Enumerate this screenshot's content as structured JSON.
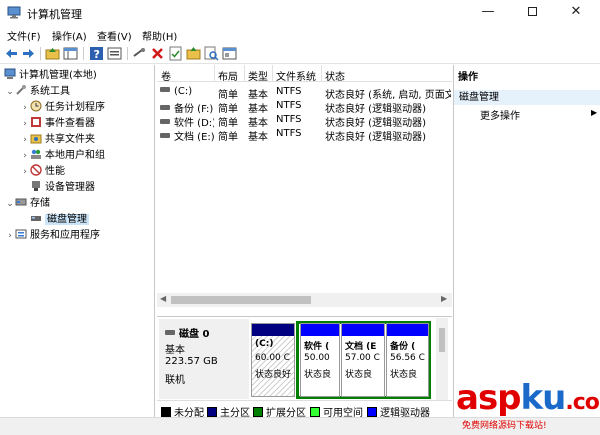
{
  "window": {
    "title": "计算机管理",
    "minimize": "—",
    "close": "✕"
  },
  "menu": [
    "文件(F)",
    "操作(A)",
    "查看(V)",
    "帮助(H)"
  ],
  "toolbar": [
    "back-icon",
    "forward-icon",
    "up-icon",
    "show-hide-tree-icon",
    "help-icon",
    "properties-icon",
    "connect-icon",
    "delete-icon",
    "check-icon",
    "folder-icon",
    "search-icon",
    "new-window-icon"
  ],
  "tree": {
    "root": "计算机管理(本地)",
    "system_tools": "系统工具",
    "task_scheduler": "任务计划程序",
    "event_viewer": "事件查看器",
    "shared_folders": "共享文件夹",
    "local_users": "本地用户和组",
    "performance": "性能",
    "device_manager": "设备管理器",
    "storage": "存储",
    "disk_management": "磁盘管理",
    "services_apps": "服务和应用程序"
  },
  "volumes": {
    "headers": [
      "卷",
      "布局",
      "类型",
      "文件系统",
      "状态"
    ],
    "rows": [
      {
        "name": "(C:)",
        "layout": "简单",
        "type": "基本",
        "fs": "NTFS",
        "status": "状态良好 (系统, 启动, 页面文"
      },
      {
        "name": "备份 (F:)",
        "layout": "简单",
        "type": "基本",
        "fs": "NTFS",
        "status": "状态良好 (逻辑驱动器)"
      },
      {
        "name": "软件 (D:)",
        "layout": "简单",
        "type": "基本",
        "fs": "NTFS",
        "status": "状态良好 (逻辑驱动器)"
      },
      {
        "name": "文档 (E:)",
        "layout": "简单",
        "type": "基本",
        "fs": "NTFS",
        "status": "状态良好 (逻辑驱动器)"
      }
    ]
  },
  "disk": {
    "name": "磁盘 0",
    "type": "基本",
    "size": "223.57 GB",
    "state": "联机",
    "partitions": [
      {
        "name": "(C:)",
        "size": "60.00 C",
        "status": "状态良好"
      },
      {
        "name": "软件 (",
        "size": "50.00",
        "status": "状态良"
      },
      {
        "name": "文档 (E",
        "size": "57.00 C",
        "status": "状态良"
      },
      {
        "name": "备份 (",
        "size": "56.56 C",
        "status": "状态良"
      }
    ]
  },
  "legend": [
    {
      "label": "未分配",
      "color": "#000000"
    },
    {
      "label": "主分区",
      "color": "#000080"
    },
    {
      "label": "扩展分区",
      "color": "#008000"
    },
    {
      "label": "可用空间",
      "color": "#33ff33"
    },
    {
      "label": "逻辑驱动器",
      "color": "#0000ff"
    }
  ],
  "actions": {
    "header": "操作",
    "section": "磁盘管理",
    "more": "更多操作"
  },
  "watermark": {
    "logo_a": "asp",
    "logo_b": "ku",
    "logo_c": ".com",
    "sub": "免费网络源码下载站!"
  }
}
